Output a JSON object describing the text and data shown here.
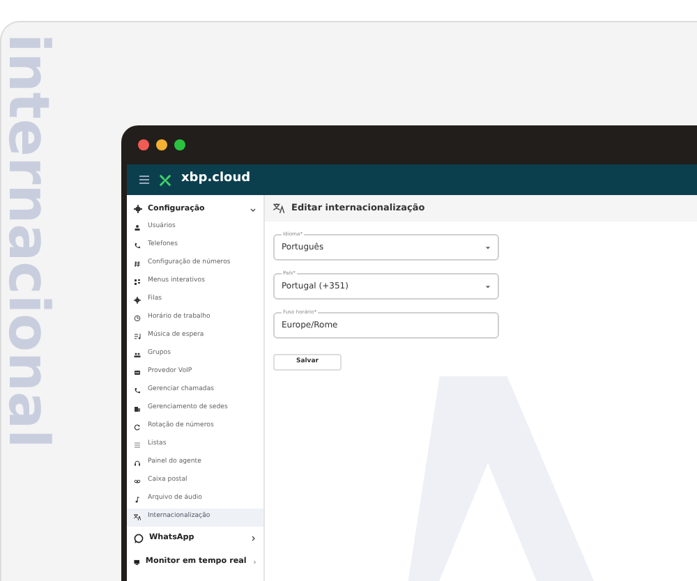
{
  "side_text": "internacional",
  "window": {
    "brand": "xbp.cloud"
  },
  "sidebar": {
    "section": {
      "label": "Configuração",
      "expanded": true
    },
    "items": [
      {
        "label": "Usuários",
        "selected": false
      },
      {
        "label": "Telefones",
        "selected": false
      },
      {
        "label": "Configuração de números",
        "selected": false
      },
      {
        "label": "Menus interativos",
        "selected": false
      },
      {
        "label": "Filas",
        "selected": false
      },
      {
        "label": "Horário de trabalho",
        "selected": false
      },
      {
        "label": "Música de espera",
        "selected": false
      },
      {
        "label": "Grupos",
        "selected": false
      },
      {
        "label": "Provedor VoIP",
        "selected": false
      },
      {
        "label": "Gerenciar chamadas",
        "selected": false
      },
      {
        "label": "Gerenciamento de sedes",
        "selected": false
      },
      {
        "label": "Rotação de números",
        "selected": false
      },
      {
        "label": "Listas",
        "selected": false
      },
      {
        "label": "Painel do agente",
        "selected": false
      },
      {
        "label": "Caixa postal",
        "selected": false
      },
      {
        "label": "Arquivo de áudio",
        "selected": false
      },
      {
        "label": "Internacionalização",
        "selected": true
      }
    ],
    "sections": [
      {
        "label": "WhatsApp",
        "expanded": false
      },
      {
        "label": "Monitor em tempo real",
        "expanded": false
      }
    ]
  },
  "page": {
    "title": "Editar internacionalização",
    "fields": [
      {
        "label": "Idioma*",
        "value": "Português",
        "kind": "select"
      },
      {
        "label": "País*",
        "value": "Portugal (+351)",
        "kind": "select"
      },
      {
        "label": "Fuso horário*",
        "value": "Europe/Rome",
        "kind": "text"
      }
    ],
    "button": "Salvar"
  }
}
